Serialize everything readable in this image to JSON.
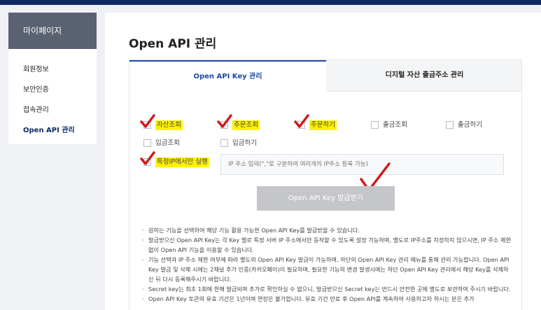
{
  "sidebar": {
    "title": "마이페이지",
    "items": [
      {
        "label": "회원정보",
        "active": false
      },
      {
        "label": "보안인증",
        "active": false
      },
      {
        "label": "접속관리",
        "active": false
      },
      {
        "label": "Open API 관리",
        "active": true
      }
    ]
  },
  "main": {
    "title": "Open API 관리",
    "tabs": [
      {
        "label": "Open API Key 관리",
        "active": true
      },
      {
        "label": "디지털 자산 출금주소 관리",
        "active": false
      }
    ],
    "permissions": [
      {
        "label": "자산조회",
        "checked": true,
        "highlighted": true
      },
      {
        "label": "주문조회",
        "checked": true,
        "highlighted": true
      },
      {
        "label": "주문하기",
        "checked": true,
        "highlighted": true
      },
      {
        "label": "출금조회",
        "checked": false,
        "highlighted": false
      },
      {
        "label": "출금하기",
        "checked": false,
        "highlighted": false
      },
      {
        "label": "입금조회",
        "checked": false,
        "highlighted": false
      },
      {
        "label": "입금하기",
        "checked": false,
        "highlighted": false
      }
    ],
    "ip_restriction": {
      "label": "특정IP에서만 실행",
      "checked": true,
      "placeholder": "IP 주소 입력(\",\"로 구분하여 여러개의 IP주소 등록 가능)"
    },
    "issue_button": "Open API Key 발급받기",
    "notes": [
      "원하는 기능을 선택하여 해당 기능 활용 가능한 Open API Key를 발급받을 수 있습니다.",
      "발급받으신 Open API Key는 각 Key 별로 특정 서버 IP 주소에서만 동작할 수 있도록 설정 가능하며, 별도로 IP주소를 지정하지 않으시면, IP 주소 제한 없이 Open API 기능을 이용할 수 있습니다.",
      "기능 선택과 IP 주소 제한 여부에 따라 별도의 Open API Key 발급이 가능하며, 하단의 Open API Key 관리 메뉴를 통해 관리 가능합니다. Open API Key 발급 및 삭제 시에는 2채널 추가 인증(카카오페이)이 필요하며, 필요한 기능의 변경 발생시에는 하단 Open API Key 관리에서 해당 Key를 삭제하신 뒤 다시 등록해주시기 바랍니다.",
      "Secret key는 최초 1회에 한해 발급되며 추가로 확인하실 수 없으니, 발급받으신 Secret key는 반드시 안전한 곳에 별도로 보관하여 주시기 바랍니다.",
      "Open API Key 토큰의 유효 기간은 1년이며 연장은 불가합니다. 유효 기간 만료 후 Open API를 계속하여 사용하고자 하시는 분은 추가"
    ]
  },
  "colors": {
    "brand": "#0e2a62",
    "tab_accent": "#1d4aa3",
    "highlight": "#fff200",
    "annotation_check": "#d21a1a"
  }
}
